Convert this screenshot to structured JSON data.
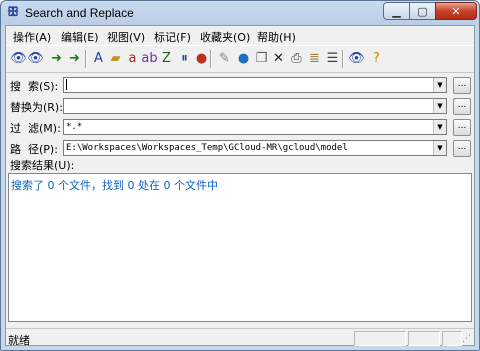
{
  "window": {
    "title": "Search and Replace"
  },
  "menu": [
    "操作(A)",
    "编辑(E)",
    "视图(V)",
    "标记(F)",
    "收藏夹(O)",
    "帮助(H)"
  ],
  "toolbar": [
    {
      "icon": "binoculars-icon",
      "glyph": "👁",
      "color": "#1f3fa8"
    },
    {
      "icon": "binoculars-double-icon",
      "glyph": "👁",
      "color": "#1f3fa8"
    },
    {
      "icon": "export-icon",
      "glyph": "➜",
      "color": "#1e7a1e"
    },
    {
      "icon": "import-icon",
      "glyph": "➜",
      "color": "#1e7a1e"
    },
    {
      "icon": "find-text-icon",
      "glyph": "A",
      "color": "#2040a0"
    },
    {
      "icon": "find-folder-icon",
      "glyph": "▰",
      "color": "#c09020"
    },
    {
      "icon": "replace-text-icon",
      "glyph": "a",
      "color": "#b02020"
    },
    {
      "icon": "replace-ab-icon",
      "glyph": "ab",
      "color": "#7030a0"
    },
    {
      "icon": "find-zip-icon",
      "glyph": "Z",
      "color": "#206020"
    },
    {
      "icon": "search-pause-icon",
      "glyph": "⏸",
      "color": "#2040a0"
    },
    {
      "icon": "globe-stop-icon",
      "glyph": "●",
      "color": "#c03020"
    },
    {
      "icon": "wrench-icon",
      "glyph": "✎",
      "color": "#808080"
    },
    {
      "icon": "globe-icon",
      "glyph": "●",
      "color": "#1a6fc0"
    },
    {
      "icon": "copy-icon",
      "glyph": "❐",
      "color": "#606060"
    },
    {
      "icon": "delete-icon",
      "glyph": "✕",
      "color": "#202020"
    },
    {
      "icon": "print-icon",
      "glyph": "⎙",
      "color": "#404040"
    },
    {
      "icon": "scroll-icon",
      "glyph": "≣",
      "color": "#a08040"
    },
    {
      "icon": "list-icon",
      "glyph": "☰",
      "color": "#404040"
    },
    {
      "icon": "find-list-icon",
      "glyph": "👁",
      "color": "#1f3fa8"
    },
    {
      "icon": "help-icon",
      "glyph": "?",
      "color": "#c08a00"
    }
  ],
  "fields": {
    "search": {
      "label": "搜  索(S):",
      "value": ""
    },
    "replace": {
      "label": "替换为(R):",
      "value": ""
    },
    "filter": {
      "label": "过  滤(M):",
      "value": "*.*"
    },
    "path": {
      "label": "路  径(P):",
      "value": "E:\\Workspaces\\Workspaces_Temp\\GCloud-MR\\gcloud\\model"
    }
  },
  "browse_label": "...",
  "results": {
    "label": "搜索结果(U):",
    "message": "搜索了 0 个文件，找到 0 处在 0 个文件中",
    "message_color": "#1060c0"
  },
  "status": {
    "text": "就绪"
  }
}
